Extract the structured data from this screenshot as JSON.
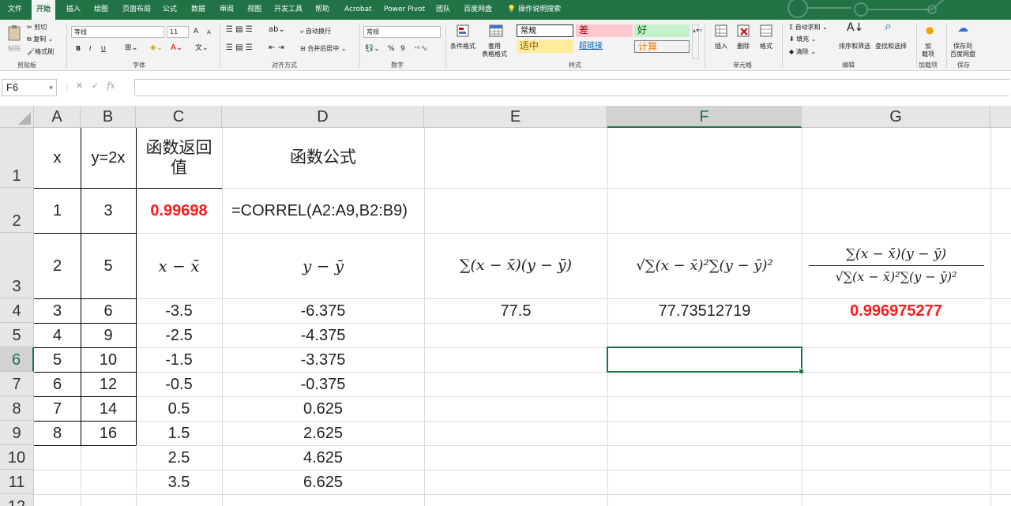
{
  "ribbon": {
    "tabs": [
      "文件",
      "开始",
      "插入",
      "绘图",
      "页面布局",
      "公式",
      "数据",
      "审阅",
      "视图",
      "开发工具",
      "帮助",
      "Acrobat",
      "Power Pivot",
      "团队",
      "百度网盘",
      "操作说明搜索"
    ],
    "active_tab": "开始",
    "clipboard": {
      "paste": "粘贴",
      "cut": "剪切",
      "copy": "复制",
      "format_painter": "格式刷",
      "label": "剪贴板"
    },
    "font": {
      "name": "等线",
      "size": "11",
      "bold": "B",
      "italic": "I",
      "underline": "U",
      "grow": "A",
      "shrink": "A",
      "label": "字体"
    },
    "alignment": {
      "wrap": "自动换行",
      "merge": "合并后居中",
      "label": "对齐方式"
    },
    "number": {
      "format": "常规",
      "percent": "%",
      "comma": "9",
      "label": "数字"
    },
    "styles": {
      "conditional": "条件格式",
      "table": "套用\n表格格式",
      "normal": "常规",
      "bad": "差",
      "good": "好",
      "neutral": "适中",
      "hyperlink": "超链接",
      "calc": "计算",
      "label": "样式"
    },
    "cells": {
      "insert": "插入",
      "delete": "删除",
      "format": "格式",
      "label": "单元格"
    },
    "editing": {
      "autosum": "自动求和",
      "fill": "填充",
      "clear": "清除",
      "sort": "排序和筛选",
      "find": "查找和选择",
      "label": "编辑"
    },
    "addins": {
      "load": "加\n载项",
      "label": "加载项"
    },
    "save": {
      "save_baidu": "保存到\n百度网盘",
      "label": "保存"
    },
    "colors": {
      "accent": "#217346",
      "bad_bg": "#ffc7ce",
      "bad_fg": "#9c0006",
      "good_bg": "#c6efce",
      "good_fg": "#006100",
      "neutral_bg": "#ffeb9c",
      "neutral_fg": "#9c5700"
    }
  },
  "formula_bar": {
    "name_box": "F6",
    "fx": "fx",
    "formula": ""
  },
  "columns": [
    "A",
    "B",
    "C",
    "D",
    "E",
    "F",
    "G"
  ],
  "selected_column": "F",
  "rows": [
    "1",
    "2",
    "3",
    "4",
    "5",
    "6",
    "7",
    "8",
    "9",
    "10",
    "11",
    "12"
  ],
  "selected_row": "6",
  "cells": {
    "A1": "x",
    "B1": "y=2x",
    "C1": "函数返回值",
    "D1": "函数公式",
    "A2": "1",
    "B2": "3",
    "C2": "0.99698",
    "D2": "=CORREL(A2:A9,B2:B9)",
    "A3": "2",
    "B3": "5",
    "C3": "x − x̄",
    "D3": "y − ȳ",
    "E3": "∑(x − x̄)(y − ȳ)",
    "F3": "√∑(x − x̄)²∑(y − ȳ)²",
    "G3_num": "∑(x − x̄)(y − ȳ)",
    "G3_den": "√∑(x − x̄)²∑(y − ȳ)²",
    "A4": "3",
    "B4": "6",
    "C4": "-3.5",
    "D4": "-6.375",
    "E4": "77.5",
    "F4": "77.73512719",
    "G4": "0.996975277",
    "A5": "4",
    "B5": "9",
    "C5": "-2.5",
    "D5": "-4.375",
    "A6": "5",
    "B6": "10",
    "C6": "-1.5",
    "D6": "-3.375",
    "A7": "6",
    "B7": "12",
    "C7": "-0.5",
    "D7": "-0.375",
    "A8": "7",
    "B8": "14",
    "C8": "0.5",
    "D8": "0.625",
    "A9": "8",
    "B9": "16",
    "C9": "1.5",
    "D9": "2.625",
    "C10": "2.5",
    "D10": "4.625",
    "C11": "3.5",
    "D11": "6.625"
  }
}
